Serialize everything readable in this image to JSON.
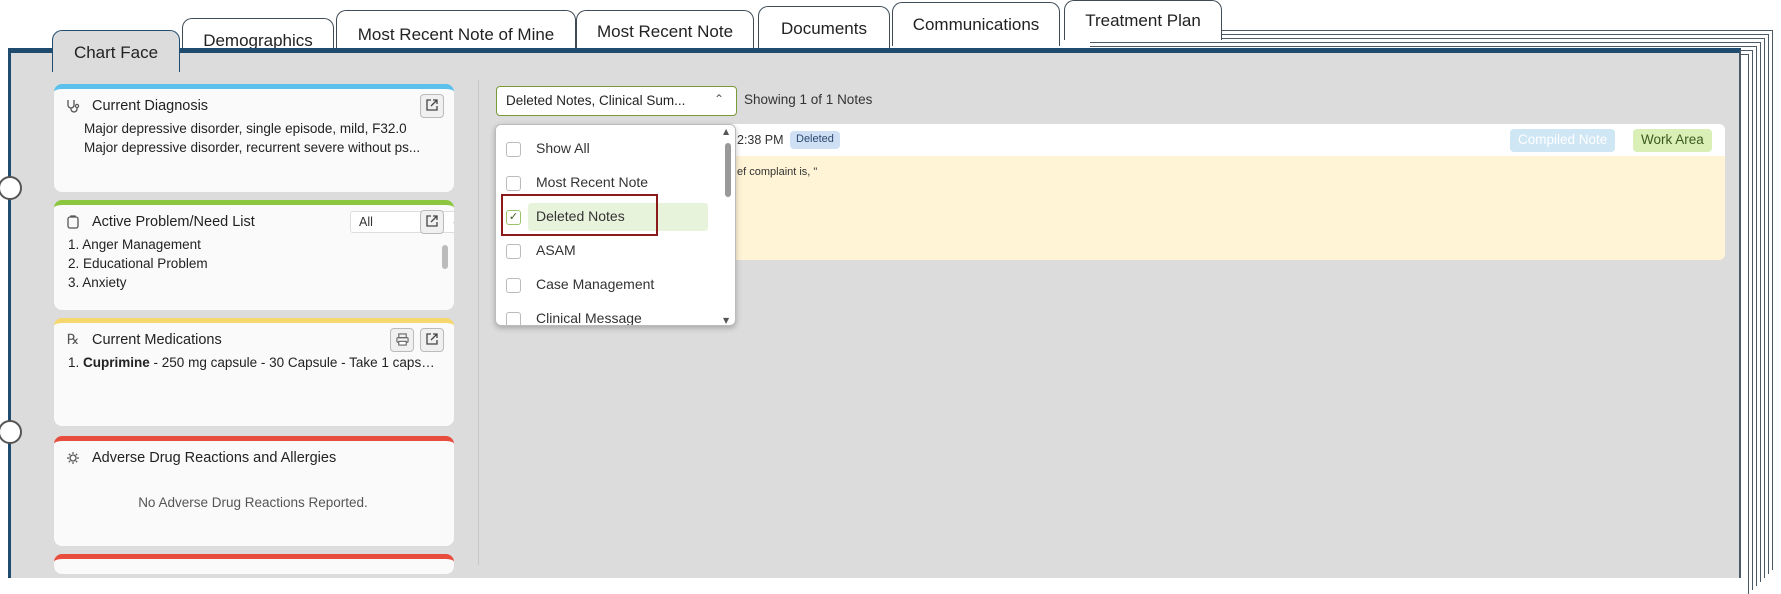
{
  "tabs": [
    {
      "label": "Chart Face",
      "active": true
    },
    {
      "label": "Demographics"
    },
    {
      "label": "Most Recent Note of Mine"
    },
    {
      "label": "Most Recent Note"
    },
    {
      "label": "Documents"
    },
    {
      "label": "Communications"
    },
    {
      "label": "Treatment Plan"
    }
  ],
  "cards": {
    "diagnosis": {
      "title": "Current Diagnosis",
      "items": [
        "Major depressive disorder, single episode, mild, F32.0",
        "Major depressive disorder, recurrent severe without ps..."
      ],
      "accent": "#5bc0eb"
    },
    "problems": {
      "title": "Active Problem/Need List",
      "filter_value": "All",
      "items": [
        "1. Anger Management",
        "2. Educational Problem",
        "3. Anxiety"
      ],
      "accent": "#8cc63f"
    },
    "medications": {
      "title": "Current Medications",
      "item_number": "1.",
      "item_name": "Cuprimine",
      "item_detail": " - 250 mg capsule - 30 Capsule - Take 1 capsul...",
      "accent": "#f5d76e"
    },
    "allergies": {
      "title": "Adverse Drug Reactions and Allergies",
      "empty_text": "No Adverse Drug Reactions Reported.",
      "accent": "#e74c3c"
    }
  },
  "notes": {
    "filter_value": "Deleted Notes, Clinical Sum...",
    "showing_text": "Showing 1 of 1 Notes",
    "note_time": "2:38 PM",
    "deleted_badge": "Deleted",
    "compiled_label": "Compiled Note",
    "work_area_label": "Work Area",
    "note_excerpt": "ef complaint is, \""
  },
  "dropdown": {
    "options": [
      {
        "label": "Show All",
        "checked": false
      },
      {
        "label": "Most Recent Note",
        "checked": false
      },
      {
        "label": "Deleted Notes",
        "checked": true
      },
      {
        "label": "ASAM",
        "checked": false
      },
      {
        "label": "Case Management",
        "checked": false
      },
      {
        "label": "Clinical Message",
        "checked": false
      }
    ]
  },
  "colors": {
    "binder_frame": "#1f4b6e",
    "filter_border": "#7a9a3a",
    "highlight_box": "#8b1a1a"
  }
}
